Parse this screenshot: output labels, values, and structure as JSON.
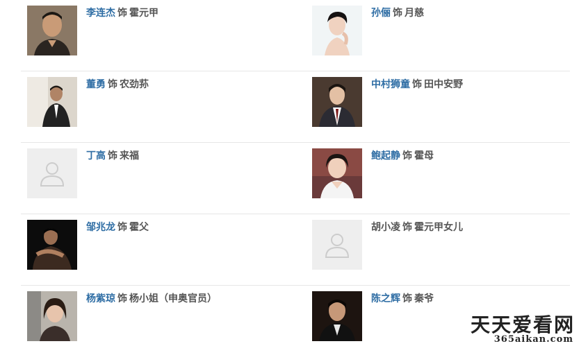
{
  "cast": [
    {
      "actor": "李连杰",
      "as": "饰",
      "role": "霍元甲",
      "photo": "portrait-man-dark-shirt",
      "linked": true
    },
    {
      "actor": "孙俪",
      "as": "饰",
      "role": "月慈",
      "photo": "portrait-woman-short-hair",
      "linked": true
    },
    {
      "actor": "董勇",
      "as": "饰",
      "role": "农劲荪",
      "photo": "portrait-man-suit",
      "linked": true
    },
    {
      "actor": "中村狮童",
      "as": "饰",
      "role": "田中安野",
      "photo": "portrait-man-suit-dark-bg",
      "linked": true
    },
    {
      "actor": "丁高",
      "as": "饰",
      "role": "来福",
      "photo": "placeholder",
      "linked": true
    },
    {
      "actor": "鲍起静",
      "as": "饰",
      "role": "霍母",
      "photo": "portrait-woman-smiling",
      "linked": true
    },
    {
      "actor": "邹兆龙",
      "as": "饰",
      "role": "霍父",
      "photo": "portrait-man-martial-arts",
      "linked": true
    },
    {
      "actor": "胡小凌",
      "as": "饰",
      "role": "霍元甲女儿",
      "photo": "placeholder",
      "linked": false
    },
    {
      "actor": "杨紫琼",
      "as": "饰",
      "role": "杨小姐（申奥官员）",
      "photo": "portrait-woman-long-hair",
      "linked": true
    },
    {
      "actor": "陈之辉",
      "as": "饰",
      "role": "秦爷",
      "photo": "portrait-man-dark-bg",
      "linked": true
    }
  ],
  "watermark": {
    "title": "天天爱看网",
    "url": "365aikan.com"
  },
  "colors": {
    "link": "#2e6da4",
    "text": "#555555",
    "divider": "#e6e6e6",
    "placeholder_bg": "#eeeeee",
    "placeholder_icon": "#cccccc"
  }
}
